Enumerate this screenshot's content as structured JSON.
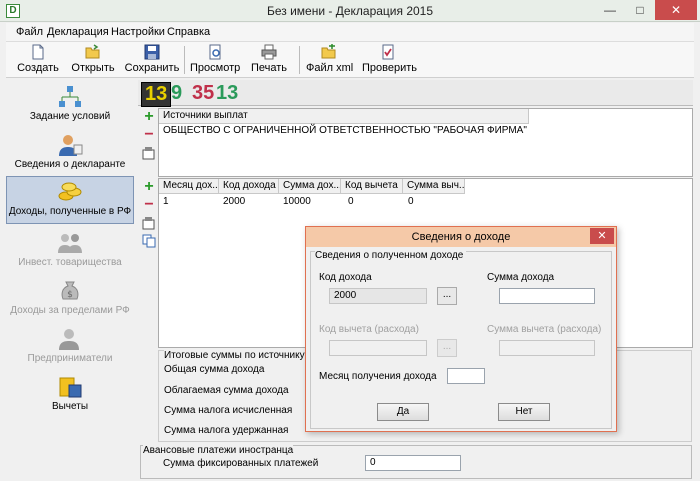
{
  "window": {
    "title": "Без имени - Декларация 2015",
    "app_icon_letter": "D",
    "minimize": "—",
    "maximize": "□",
    "close": "✕"
  },
  "menu": [
    "Файл",
    "Декларация",
    "Настройки",
    "Справка"
  ],
  "toolbar": {
    "create": "Создать",
    "open": "Открыть",
    "save": "Сохранить",
    "preview": "Просмотр",
    "print": "Печать",
    "xml": "Файл xml",
    "check": "Проверить"
  },
  "sidebar": [
    {
      "label": "Задание условий",
      "icon": "network-icon",
      "enabled": true
    },
    {
      "label": "Сведения о декларанте",
      "icon": "user-icon",
      "enabled": true
    },
    {
      "label": "Доходы, полученные в РФ",
      "icon": "coins-icon",
      "enabled": true,
      "active": true
    },
    {
      "label": "Инвест. товарищества",
      "icon": "partners-icon",
      "enabled": false
    },
    {
      "label": "Доходы за пределами РФ",
      "icon": "moneybag-icon",
      "enabled": false
    },
    {
      "label": "Предприниматели",
      "icon": "businessman-icon",
      "enabled": false
    },
    {
      "label": "Вычеты",
      "icon": "deductions-icon",
      "enabled": true
    }
  ],
  "rates": [
    {
      "value": "13",
      "color": "#e8d000"
    },
    {
      "value": "9",
      "color": "#2a9a5a"
    },
    {
      "value": "35",
      "color": "#c0304a"
    },
    {
      "value": "13",
      "color": "#2a9a5a"
    }
  ],
  "sources": {
    "header": "Источники выплат",
    "rows": [
      "ОБЩЕСТВО С ОГРАНИЧЕННОЙ ОТВЕТСТВЕННОСТЬЮ \"РАБОЧАЯ ФИРМА\""
    ]
  },
  "income": {
    "headers": [
      "Месяц дох...",
      "Код дохода",
      "Сумма дох...",
      "Код вычета",
      "Сумма выч..."
    ],
    "rows": [
      [
        "1",
        "2000",
        "10000",
        "0",
        "0"
      ]
    ]
  },
  "totals": {
    "header": "Итоговые суммы по источнику в",
    "rows": [
      "Общая сумма дохода",
      "Облагаемая сумма дохода",
      "Сумма налога исчисленная",
      "Сумма налога удержанная"
    ]
  },
  "advance": {
    "header": "Авансовые платежи иностранца",
    "label": "Сумма фиксированных платежей",
    "value": "0"
  },
  "dialog": {
    "title": "Сведения о доходе",
    "close": "✕",
    "group": "Сведения о полученном доходе",
    "income_code_label": "Код дохода",
    "income_code_value": "2000",
    "income_sum_label": "Сумма дохода",
    "income_sum_value": "",
    "deduction_code_label": "Код вычета (расхода)",
    "deduction_code_value": "",
    "deduction_sum_label": "Сумма вычета (расхода)",
    "deduction_sum_value": "",
    "month_label": "Месяц получения дохода",
    "month_value": "",
    "dots": "...",
    "yes": "Да",
    "no": "Нет"
  }
}
